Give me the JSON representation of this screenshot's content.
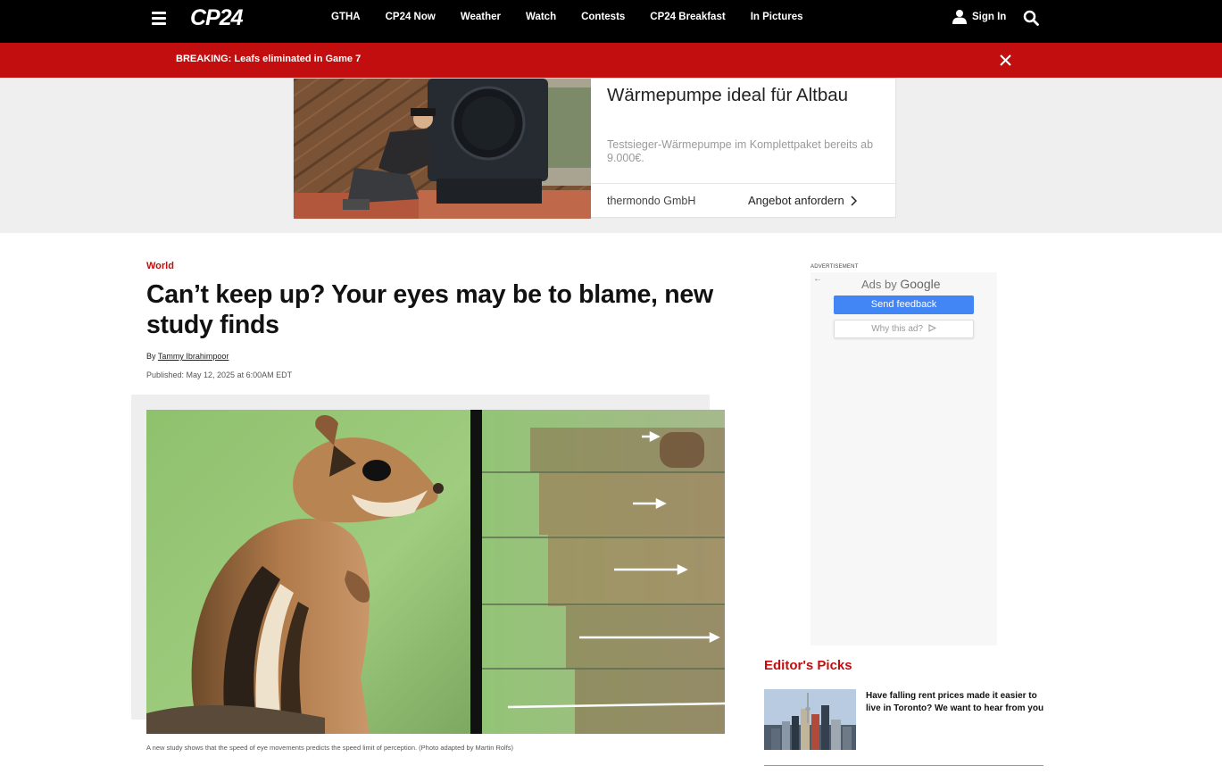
{
  "header": {
    "logo_text": "CP24",
    "nav": [
      "GTHA",
      "CP24 Now",
      "Weather",
      "Watch",
      "Contests",
      "CP24 Breakfast",
      "In Pictures"
    ],
    "signin_label": "Sign In"
  },
  "breaking": {
    "text": "BREAKING: Leafs eliminated in Game 7"
  },
  "top_ad": {
    "title": "Wärmepumpe ideal für Altbau",
    "subtitle": "Testsieger-Wärmepumpe im Komplettpaket bereits ab 9.000€.",
    "advertiser": "thermondo GmbH",
    "cta": "Angebot anfordern"
  },
  "article": {
    "category": "World",
    "headline": "Can’t keep up? Your eyes may be to blame, new study finds",
    "byline_prefix": "By",
    "author": "Tammy Ibrahimpoor",
    "published": "Published: May 12, 2025 at 6:00AM EDT",
    "caption": "A new study shows that the speed of eye movements predicts the speed limit of perception. (Photo adapted by Martin Rolfs)"
  },
  "sidebar": {
    "adv_label": "ADVERTISEMENT",
    "ads_by_prefix": "Ads by",
    "ads_by_brand": "Google",
    "feedback_button": "Send feedback",
    "why_button": "Why this ad?",
    "picks_title": "Editor's Picks",
    "picks": [
      {
        "title": "Have falling rent prices made it easier to live in Toronto? We want to hear from you"
      }
    ]
  },
  "colors": {
    "brand_red": "#c20e0e",
    "nav_bg": "#000000",
    "google_blue": "#4285f4"
  }
}
